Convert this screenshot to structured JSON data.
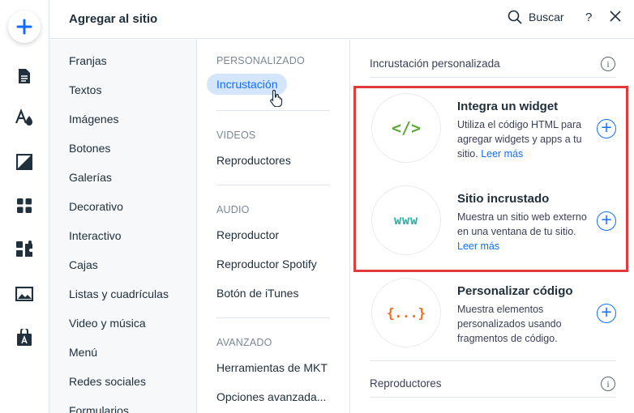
{
  "header": {
    "title": "Agregar al sitio",
    "search_label": "Buscar",
    "help_label": "?"
  },
  "rail": {
    "icons": [
      "plus-icon",
      "page-icon",
      "text-theme-icon",
      "background-icon",
      "apps-icon",
      "puzzle-icon",
      "media-icon",
      "business-icon"
    ]
  },
  "categories": [
    "Franjas",
    "Textos",
    "Imágenes",
    "Botones",
    "Galerías",
    "Decorativo",
    "Interactivo",
    "Cajas",
    "Listas y cuadrículas",
    "Video y música",
    "Menú",
    "Redes sociales",
    "Formularios"
  ],
  "subcategories": {
    "personalizado": {
      "heading": "PERSONALIZADO",
      "items": [
        "Incrustación"
      ]
    },
    "videos": {
      "heading": "VIDEOS",
      "items": [
        "Reproductores"
      ]
    },
    "audio": {
      "heading": "AUDIO",
      "items": [
        "Reproductor",
        "Reproductor Spotify",
        "Botón de iTunes"
      ]
    },
    "avanzado": {
      "heading": "AVANZADO",
      "items": [
        "Herramientas de MKT",
        "Opciones avanzada..."
      ]
    }
  },
  "content": {
    "section_title": "Incrustación personalizada",
    "info_label": "i",
    "items": [
      {
        "icon_text": "</>",
        "title": "Integra un widget",
        "desc": "Utiliza el código HTML para agregar widgets y apps a tu sitio.",
        "link": "Leer más",
        "color": "#5fa83a"
      },
      {
        "icon_text": "www",
        "title": "Sitio incrustado",
        "desc": "Muestra un sitio web externo en una ventana de tu sitio.",
        "link": "Leer más",
        "color": "#1ab5a8"
      },
      {
        "icon_text": "{...}",
        "title": "Personalizar código",
        "desc": "Muestra elementos personalizados usando fragmentos de código.",
        "link": "",
        "color": "#f26a1b"
      }
    ],
    "next_section_title": "Reproductores",
    "plus_label": "+"
  },
  "colors": {
    "accent": "#116dff",
    "highlight": "#e2393d",
    "active_bg": "#d3e6fb"
  }
}
